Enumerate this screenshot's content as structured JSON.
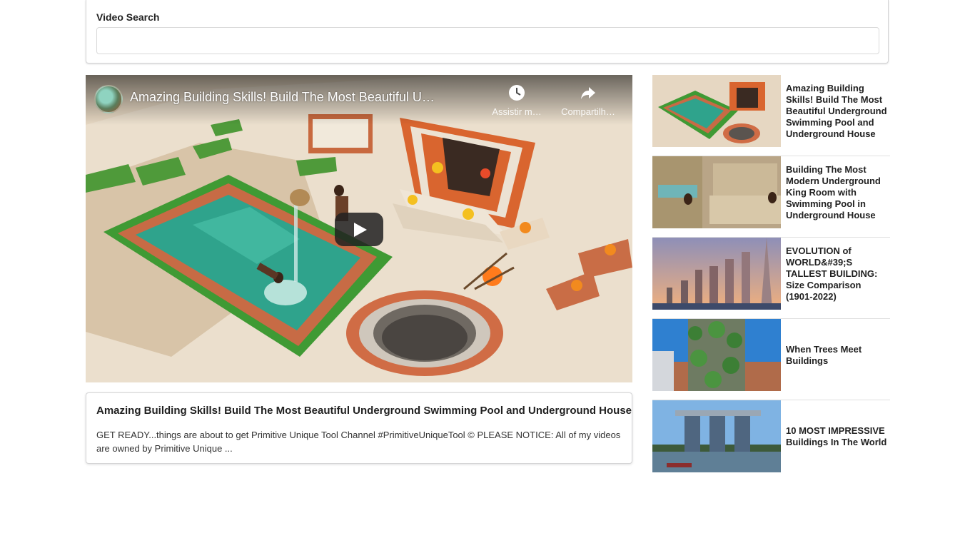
{
  "search": {
    "label": "Video Search",
    "value": "",
    "placeholder": ""
  },
  "player": {
    "title": "Amazing Building Skills! Build The Most Beautiful Undergrou…",
    "watch_later_label": "Assistir m…",
    "share_label": "Compartilh…",
    "icons": {
      "avatar": "channel-avatar",
      "watch_later": "clock-icon",
      "share": "share-icon",
      "play": "play-icon"
    }
  },
  "selected": {
    "title": "Amazing Building Skills! Build The Most Beautiful Underground Swimming Pool and Underground House",
    "description": "GET READY...things are about to get Primitive Unique Tool Channel #PrimitiveUniqueTool © PLEASE NOTICE: All of my videos are owned by Primitive Unique ..."
  },
  "videos": [
    {
      "title": "Amazing Building Skills! Build The Most Beautiful Underground Swimming Pool and Underground House"
    },
    {
      "title": "Building The Most Modern Underground King Room with Swimming Pool in Underground House"
    },
    {
      "title": "EVOLUTION of WORLD&#39;S TALLEST BUILDING: Size Comparison (1901-2022)"
    },
    {
      "title": "When Trees Meet Buildings"
    },
    {
      "title": "10 MOST IMPRESSIVE Buildings In The World"
    }
  ]
}
